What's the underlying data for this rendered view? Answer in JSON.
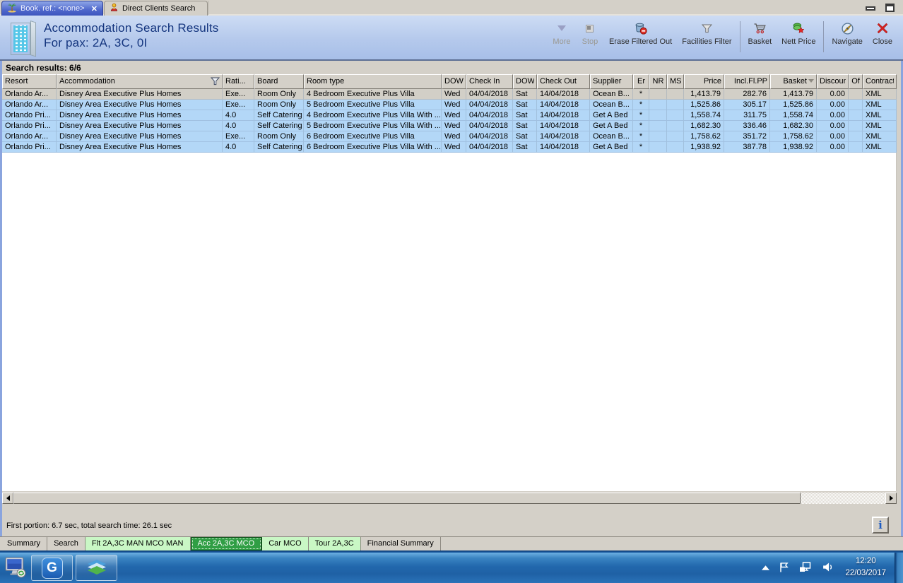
{
  "colors": {
    "row_blue": "#b3d7f7",
    "row_selected_gray": "#d2cfc7",
    "header_blue": "#b5c9ec",
    "title_navy": "#14357e",
    "active_bottom_tab_green": "#2f9e44",
    "light_green_tab": "#c9f7c5",
    "taskbar_blue": "#2268ad"
  },
  "tab_bar": {
    "tabs": [
      {
        "label": "Book. ref.: <none>",
        "active": true
      },
      {
        "label": "Direct Clients Search",
        "active": false
      }
    ]
  },
  "header": {
    "title_line1": "Accommodation Search Results",
    "title_line2": "For pax: 2A, 3C, 0I",
    "toolbar": [
      {
        "label": "More",
        "icon": "more-arrow-icon",
        "disabled": true
      },
      {
        "label": "Stop",
        "icon": "stop-square-icon",
        "disabled": true
      },
      {
        "label": "Erase Filtered Out",
        "icon": "erase-trash-icon",
        "disabled": false
      },
      {
        "label": "Facilities Filter",
        "icon": "filter-funnel-icon",
        "disabled": false
      },
      {
        "label": "Basket",
        "icon": "shopping-cart-icon",
        "disabled": false
      },
      {
        "label": "Nett Price",
        "icon": "nett-price-icon",
        "disabled": false
      },
      {
        "label": "Navigate",
        "icon": "compass-icon",
        "disabled": false
      },
      {
        "label": "Close",
        "icon": "red-x-icon",
        "disabled": false
      }
    ]
  },
  "results": {
    "summary_label": "Search results: 6/6",
    "columns": [
      "Resort",
      "Accommodation",
      "Rati...",
      "Board",
      "Room type",
      "DOW",
      "Check In",
      "DOW",
      "Check Out",
      "Supplier",
      "Er",
      "NR",
      "MS",
      "Price",
      "Incl.Fl.PP",
      "Basket",
      "Discount",
      "Of",
      "Contract"
    ],
    "selected_row_index": 0,
    "rows": [
      [
        "Orlando Ar...",
        "Disney Area Executive Plus Homes",
        "Exe...",
        "Room Only",
        "4 Bedroom Executive Plus Villa",
        "Wed",
        "04/04/2018",
        "Sat",
        "14/04/2018",
        "Ocean B...",
        "*",
        "",
        "",
        "1,413.79",
        "282.76",
        "1,413.79",
        "0.00",
        "",
        "XML"
      ],
      [
        "Orlando Ar...",
        "Disney Area Executive Plus Homes",
        "Exe...",
        "Room Only",
        "5 Bedroom Executive Plus Villa",
        "Wed",
        "04/04/2018",
        "Sat",
        "14/04/2018",
        "Ocean B...",
        "*",
        "",
        "",
        "1,525.86",
        "305.17",
        "1,525.86",
        "0.00",
        "",
        "XML"
      ],
      [
        "Orlando Pri...",
        "Disney Area Executive Plus Homes",
        "4.0",
        "Self Catering",
        "4 Bedroom Executive Plus Villa With ...",
        "Wed",
        "04/04/2018",
        "Sat",
        "14/04/2018",
        "Get A Bed",
        "*",
        "",
        "",
        "1,558.74",
        "311.75",
        "1,558.74",
        "0.00",
        "",
        "XML"
      ],
      [
        "Orlando Pri...",
        "Disney Area Executive Plus Homes",
        "4.0",
        "Self Catering",
        "5 Bedroom Executive Plus Villa With ...",
        "Wed",
        "04/04/2018",
        "Sat",
        "14/04/2018",
        "Get A Bed",
        "*",
        "",
        "",
        "1,682.30",
        "336.46",
        "1,682.30",
        "0.00",
        "",
        "XML"
      ],
      [
        "Orlando Ar...",
        "Disney Area Executive Plus Homes",
        "Exe...",
        "Room Only",
        "6 Bedroom Executive Plus Villa",
        "Wed",
        "04/04/2018",
        "Sat",
        "14/04/2018",
        "Ocean B...",
        "*",
        "",
        "",
        "1,758.62",
        "351.72",
        "1,758.62",
        "0.00",
        "",
        "XML"
      ],
      [
        "Orlando Pri...",
        "Disney Area Executive Plus Homes",
        "4.0",
        "Self Catering",
        "6 Bedroom Executive Plus Villa With ...",
        "Wed",
        "04/04/2018",
        "Sat",
        "14/04/2018",
        "Get A Bed",
        "*",
        "",
        "",
        "1,938.92",
        "387.78",
        "1,938.92",
        "0.00",
        "",
        "XML"
      ]
    ]
  },
  "status": {
    "text": "First portion: 6.7 sec, total search time: 26.1 sec",
    "info_button_label": "i"
  },
  "bottom_tabs": [
    {
      "label": "Summary",
      "style": "plain"
    },
    {
      "label": "Search",
      "style": "plain"
    },
    {
      "label": "Flt 2A,3C MAN MCO MAN",
      "style": "green"
    },
    {
      "label": "Acc 2A,3C MCO",
      "style": "green-selected"
    },
    {
      "label": "Car MCO",
      "style": "green"
    },
    {
      "label": "Tour 2A,3C",
      "style": "green"
    },
    {
      "label": "Financial Summary",
      "style": "plain"
    }
  ],
  "taskbar": {
    "g_button_letter": "G",
    "clock_time": "12:20",
    "clock_date": "22/03/2017"
  }
}
